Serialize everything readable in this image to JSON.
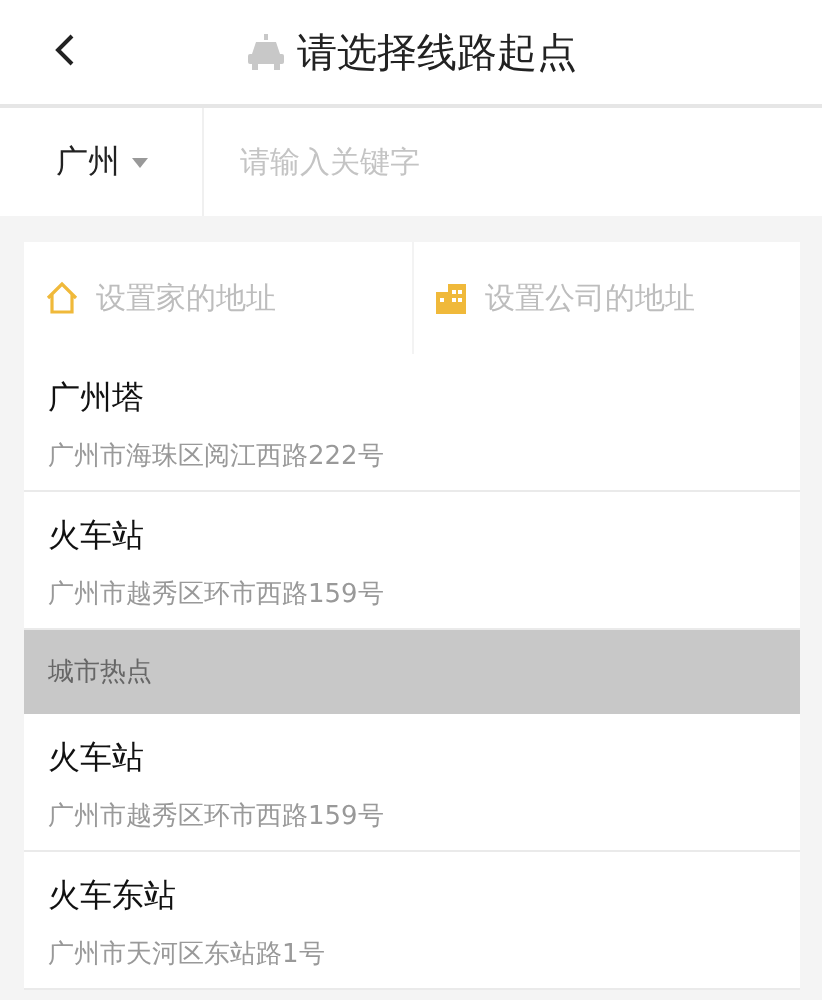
{
  "header": {
    "title": "请选择线路起点"
  },
  "search": {
    "city": "广州",
    "placeholder": "请输入关键字"
  },
  "shortcuts": [
    {
      "kind": "home",
      "label": "设置家的地址"
    },
    {
      "kind": "company",
      "label": "设置公司的地址"
    }
  ],
  "recent": [
    {
      "name": "广州塔",
      "address": "广州市海珠区阅江西路222号"
    },
    {
      "name": "火车站",
      "address": "广州市越秀区环市西路159号"
    }
  ],
  "hot": {
    "title": "城市热点",
    "places": [
      {
        "name": "火车站",
        "address": "广州市越秀区环市西路159号"
      },
      {
        "name": "火车东站",
        "address": "广州市天河区东站路1号"
      }
    ]
  }
}
